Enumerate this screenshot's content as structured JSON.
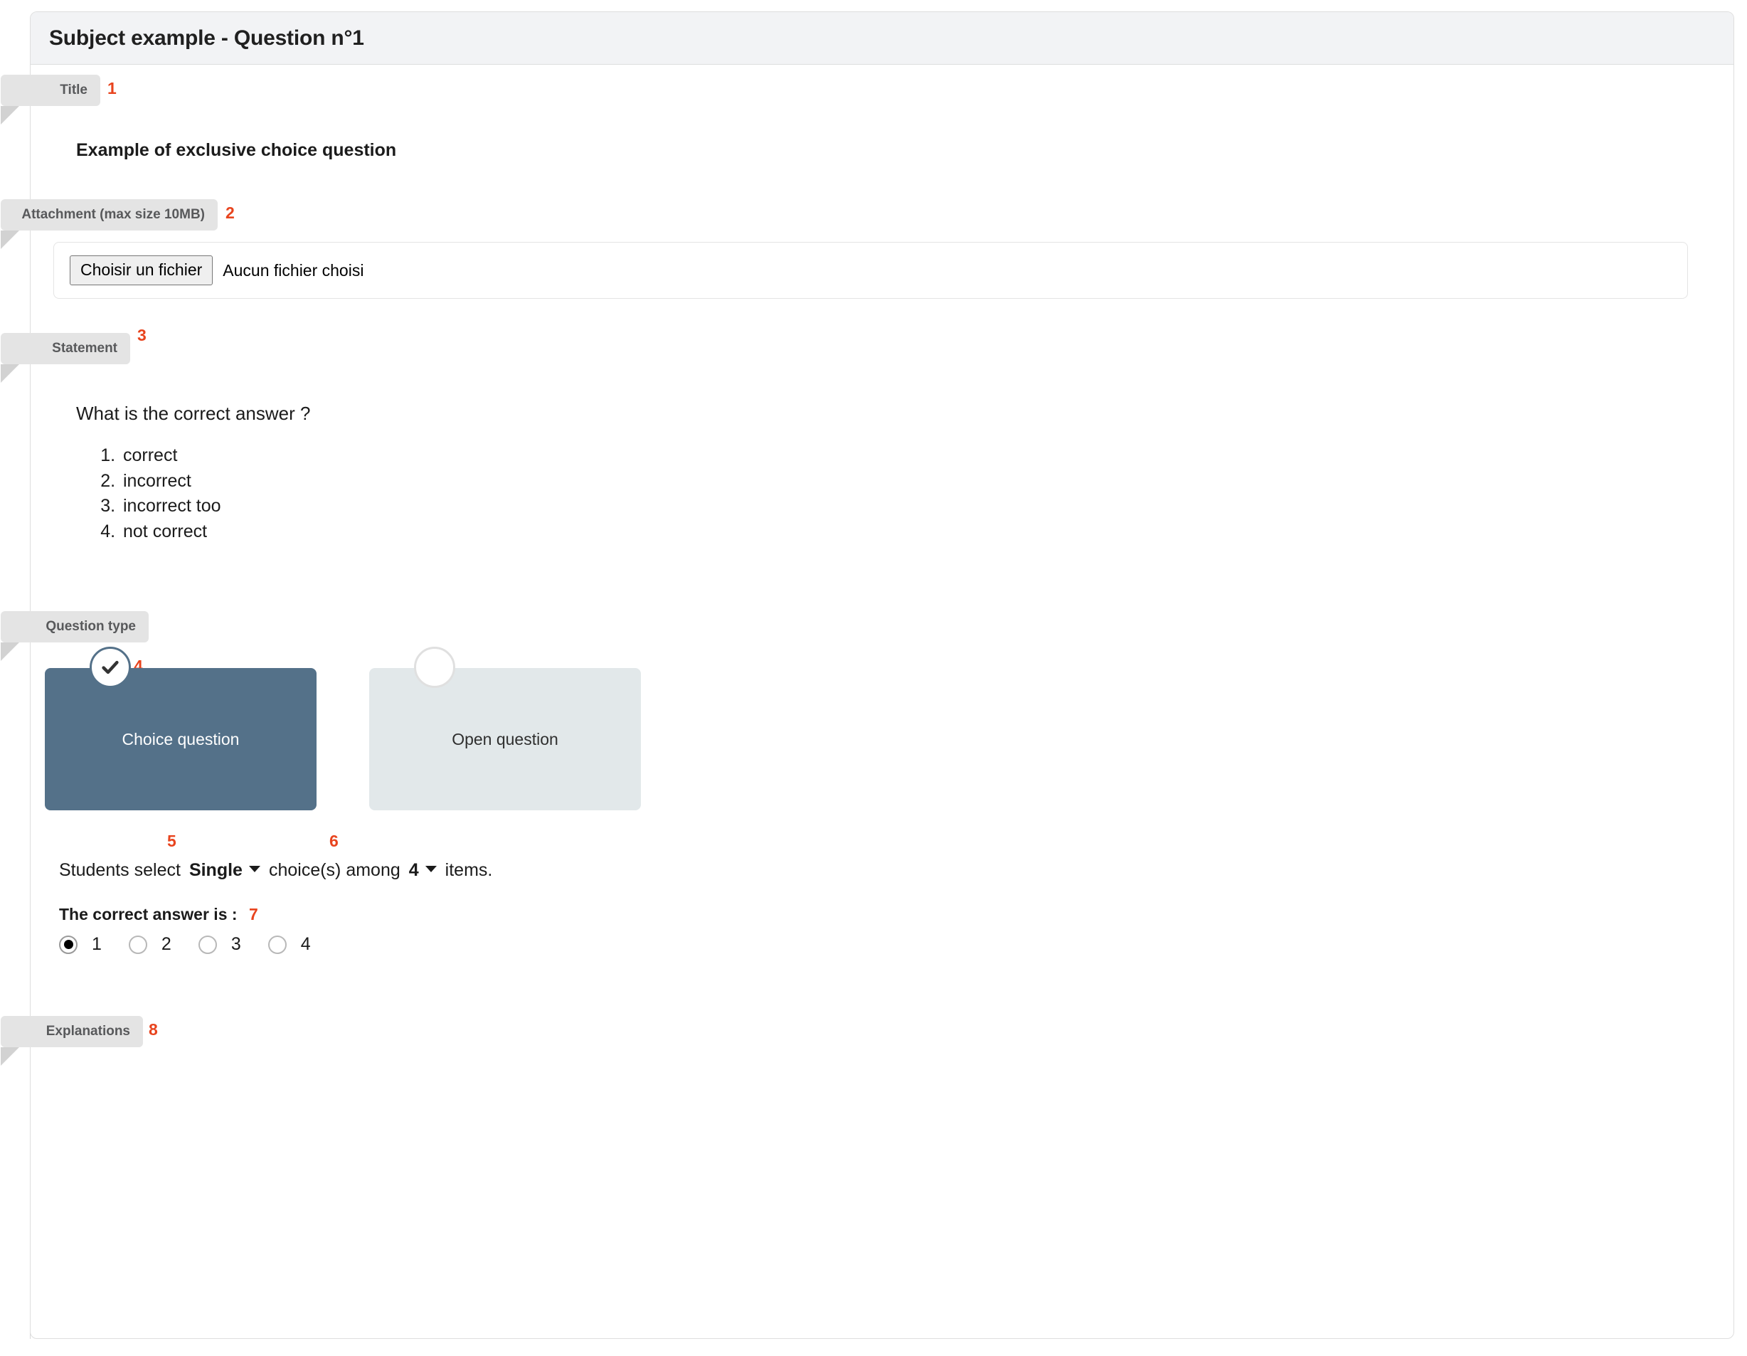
{
  "header": {
    "title": "Subject example - Question n°1"
  },
  "sections": {
    "title": {
      "badge": "Title",
      "marker": "1",
      "value": "Example of exclusive choice question"
    },
    "attachment": {
      "badge": "Attachment (max size 10MB)",
      "marker": "2",
      "button_label": "Choisir un fichier",
      "status": "Aucun fichier choisi"
    },
    "statement": {
      "badge": "Statement",
      "marker": "3",
      "question": "What is the correct answer ?",
      "items": [
        "correct",
        "incorrect",
        "incorrect too",
        "not correct"
      ]
    },
    "question_type": {
      "badge": "Question type",
      "marker": "4",
      "cards": [
        {
          "label": "Choice question",
          "selected": true,
          "check_icon": "check-icon"
        },
        {
          "label": "Open question",
          "selected": false,
          "check_icon": "empty-circle-icon"
        }
      ],
      "sentence": {
        "prefix": "Students select",
        "selection_mode": "Single",
        "selection_mode_marker": "5",
        "middle": "choice(s) among",
        "item_count": "4",
        "item_count_marker": "6",
        "suffix": "items."
      },
      "correct_answer": {
        "label": "The correct answer is :",
        "marker": "7",
        "options": [
          "1",
          "2",
          "3",
          "4"
        ],
        "selected": "1"
      }
    },
    "explanations": {
      "badge": "Explanations",
      "marker": "8"
    }
  },
  "colors": {
    "accent_selected": "#547189",
    "marker": "#e8441e",
    "badge_bg": "#e4e4e4",
    "header_bg": "#f2f3f5",
    "card_unselected": "#e2e8ea"
  }
}
